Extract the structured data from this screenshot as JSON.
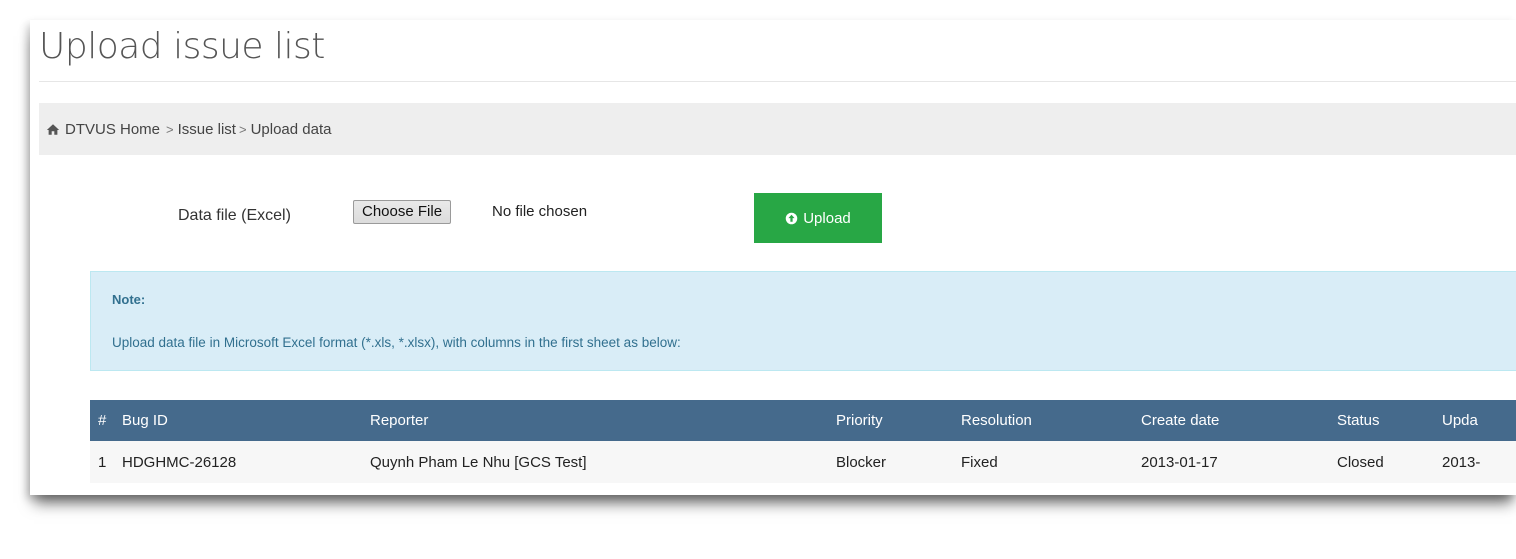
{
  "page": {
    "title": "Upload issue list"
  },
  "breadcrumb": {
    "home": "DTVUS Home",
    "separator": ">",
    "items": [
      "Issue list",
      "Upload data"
    ]
  },
  "form": {
    "file_label": "Data file (Excel)",
    "choose_label": "Choose File",
    "no_file_text": "No file chosen",
    "upload_label": "Upload"
  },
  "note": {
    "title": "Note:",
    "text": "Upload data file in Microsoft Excel format (*.xls, *.xlsx), with columns in the first sheet as below:"
  },
  "table": {
    "headers": [
      "#",
      "Bug ID",
      "Reporter",
      "Priority",
      "Resolution",
      "Create date",
      "Status",
      "Upda"
    ],
    "rows": [
      [
        "1",
        "HDGHMC-26128",
        "Quynh Pham Le Nhu [GCS Test]",
        "Blocker",
        "Fixed",
        "2013-01-17",
        "Closed",
        "2013-"
      ]
    ]
  },
  "colors": {
    "table_header": "#456a8c",
    "upload_button": "#28a745",
    "note_background": "#d9edf7",
    "note_text": "#31708f"
  },
  "icons": {
    "home": "home-icon",
    "upload": "arrow-circle-up-icon"
  }
}
